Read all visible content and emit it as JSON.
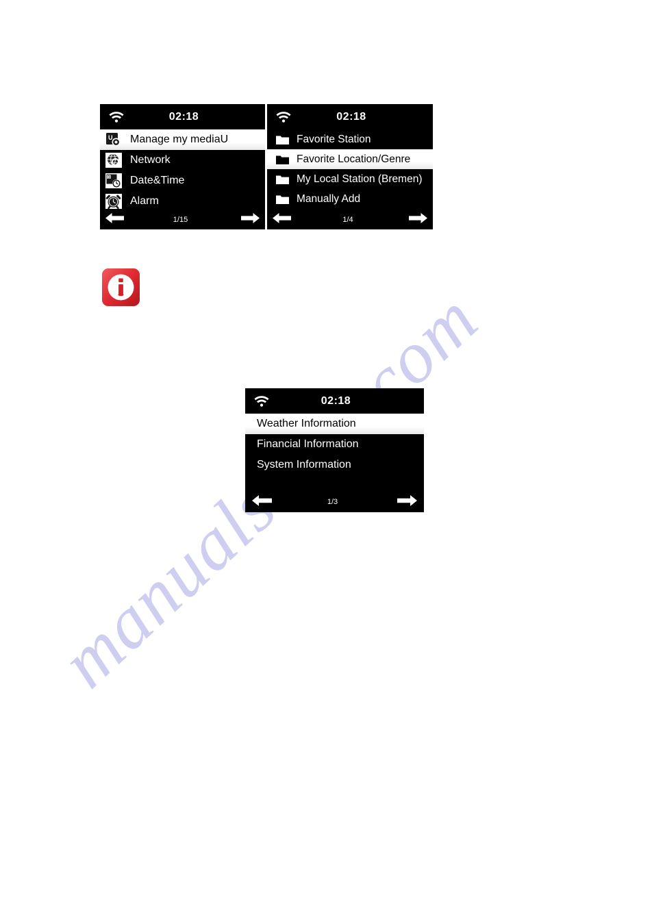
{
  "page": {
    "background_color": "#ffffff",
    "watermark_text": "manualshive.com",
    "watermark_color": "#ccccf0"
  },
  "callout": {
    "note_icon_name": "information-note-icon",
    "note_icon_glyph": "i",
    "accent_color": "#d81f26",
    "badge_color": "#e8353c"
  },
  "screens": {
    "settings": {
      "title": "Settings menu screen",
      "status_bar": {
        "wifi_icon": "wifi-icon",
        "clock": "02:18"
      },
      "items": [
        {
          "label": "Manage my mediaU",
          "icon": "mediau-icon",
          "selected": true
        },
        {
          "label": "Network",
          "icon": "network-icon",
          "selected": false
        },
        {
          "label": "Date&Time",
          "icon": "calendar-clock-icon",
          "selected": false
        },
        {
          "label": "Alarm",
          "icon": "alarm-clock-icon",
          "selected": false
        }
      ],
      "footer": {
        "prev_icon": "arrow-left-icon",
        "pager": "1/15",
        "next_icon": "arrow-right-icon"
      }
    },
    "stations": {
      "title": "Internet radio station list screen",
      "status_bar": {
        "wifi_icon": "wifi-icon",
        "clock": "02:18"
      },
      "items": [
        {
          "label": "Favorite Station",
          "icon": "folder-icon",
          "selected": false
        },
        {
          "label": "Favorite Location/Genre",
          "icon": "folder-icon",
          "selected": true
        },
        {
          "label": "My Local Station (Bremen)",
          "icon": "folder-icon",
          "selected": false
        },
        {
          "label": "Manually Add",
          "icon": "folder-icon",
          "selected": false
        }
      ],
      "footer": {
        "prev_icon": "arrow-left-icon",
        "pager": "1/4",
        "next_icon": "arrow-right-icon"
      }
    },
    "information": {
      "title": "Information menu screen",
      "status_bar": {
        "wifi_icon": "wifi-icon",
        "clock": "02:18"
      },
      "items": [
        {
          "label": "Weather Information",
          "selected": true
        },
        {
          "label": "Financial Information",
          "selected": false
        },
        {
          "label": "System Information",
          "selected": false
        }
      ],
      "footer": {
        "prev_icon": "arrow-left-icon",
        "pager": "1/3",
        "next_icon": "arrow-right-icon"
      }
    }
  }
}
